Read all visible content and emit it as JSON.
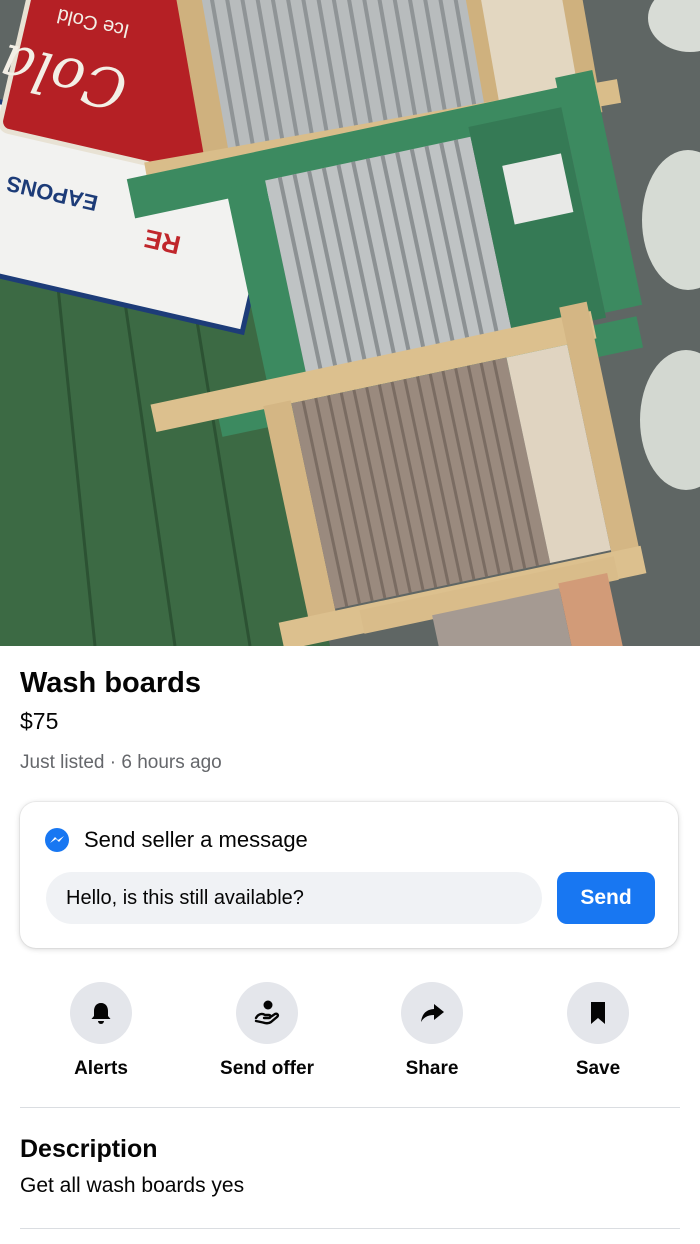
{
  "listing": {
    "title": "Wash boards",
    "price": "$75",
    "meta": "Just listed · 6 hours ago"
  },
  "message": {
    "header": "Send seller a message",
    "input_value": "Hello, is this still available?",
    "send_label": "Send"
  },
  "actions": [
    {
      "label": "Alerts",
      "icon": "bell-icon"
    },
    {
      "label": "Send offer",
      "icon": "offer-icon"
    },
    {
      "label": "Share",
      "icon": "share-arrow-icon"
    },
    {
      "label": "Save",
      "icon": "bookmark-icon"
    }
  ],
  "description": {
    "heading": "Description",
    "text": "Get all wash boards yes"
  },
  "photo": {
    "sign_text": "Ice Cold",
    "brand_script": "Cola"
  },
  "colors": {
    "accent": "#1877f2",
    "icon_bg": "#e4e6eb",
    "secondary_text": "#65676b"
  }
}
